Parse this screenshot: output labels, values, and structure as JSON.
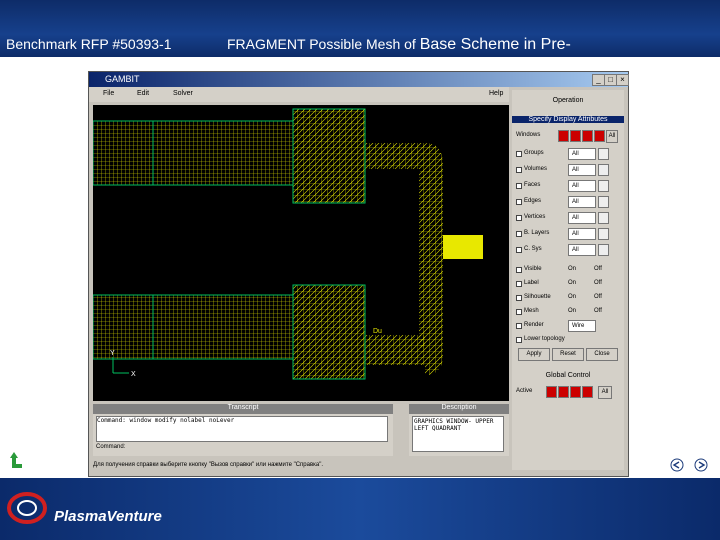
{
  "header": {
    "title_left": "Benchmark  RFP #50393-1",
    "title_main": "FRAGMENT Possible Mesh of",
    "title_big": "Base Scheme in Pre-"
  },
  "window": {
    "title": "GAMBIT",
    "menu": [
      "File",
      "Edit",
      "Solver",
      "Help"
    ]
  },
  "graphics": {
    "axis_x": "X",
    "axis_y": "Y",
    "label": "Du"
  },
  "right_panel": {
    "operation": "Operation",
    "specify": "Specify Display Attributes",
    "windows_label": "Windows",
    "rows": [
      {
        "label": "Groups",
        "value": "All"
      },
      {
        "label": "Volumes",
        "value": "All"
      },
      {
        "label": "Faces",
        "value": "All"
      },
      {
        "label": "Edges",
        "value": "All"
      },
      {
        "label": "Vertices",
        "value": "All"
      },
      {
        "label": "B. Layers",
        "value": "All"
      },
      {
        "label": "C. Sys",
        "value": "All"
      }
    ],
    "toggles": [
      {
        "label": "Visible",
        "on": "On",
        "off": "Off"
      },
      {
        "label": "Label",
        "on": "On",
        "off": "Off"
      },
      {
        "label": "Silhouette",
        "on": "On",
        "off": "Off"
      },
      {
        "label": "Mesh",
        "on": "On",
        "off": "Off"
      }
    ],
    "render_label": "Render",
    "render_value": "Wire",
    "lower_topology": "Lower topology",
    "apply": "Apply",
    "reset": "Reset",
    "close": "Close",
    "global_control": "Global Control",
    "active": "Active",
    "all": "All"
  },
  "transcript": {
    "header": "Transcript",
    "text": "Command: window modify nolabel noLever",
    "command_label": "Command:"
  },
  "description": {
    "header": "Description",
    "text": "GRAPHICS WINDOW- UPPER LEFT QUADRANT"
  },
  "status_text": "Для получения справки выберите кнопку \"Вызов справки\" или нажмите \"Справка\".",
  "footer": {
    "brand": "PlasmaVenture"
  },
  "colors": {
    "header_bg": "#16408c",
    "mesh": "#e8e800",
    "edge_green": "#00c060",
    "background": "#000000"
  }
}
